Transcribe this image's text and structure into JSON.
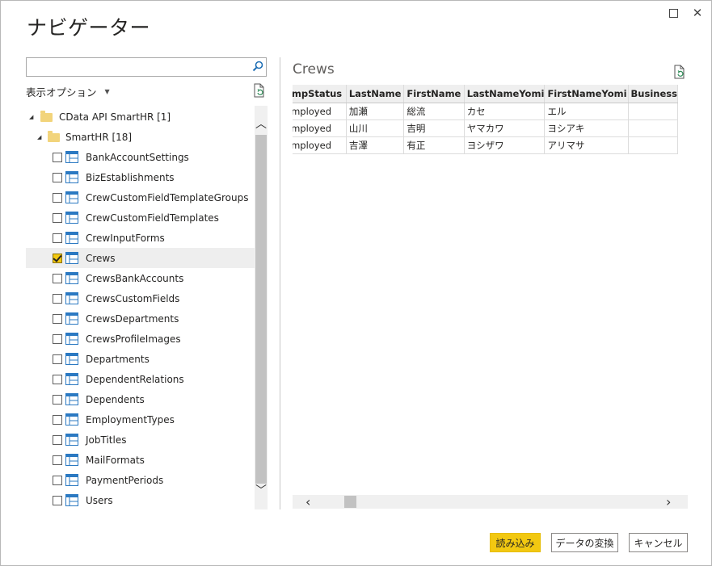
{
  "window": {
    "title": "ナビゲーター"
  },
  "navigator": {
    "search": {
      "value": "",
      "placeholder": ""
    },
    "display_options_label": "表示オプション",
    "tree": {
      "root": {
        "label": "CData API SmartHR [1]"
      },
      "folder": {
        "label": "SmartHR [18]"
      },
      "items": [
        {
          "label": "BankAccountSettings",
          "checked": false
        },
        {
          "label": "BizEstablishments",
          "checked": false
        },
        {
          "label": "CrewCustomFieldTemplateGroups",
          "checked": false
        },
        {
          "label": "CrewCustomFieldTemplates",
          "checked": false
        },
        {
          "label": "CrewInputForms",
          "checked": false
        },
        {
          "label": "Crews",
          "checked": true
        },
        {
          "label": "CrewsBankAccounts",
          "checked": false
        },
        {
          "label": "CrewsCustomFields",
          "checked": false
        },
        {
          "label": "CrewsDepartments",
          "checked": false
        },
        {
          "label": "CrewsProfileImages",
          "checked": false
        },
        {
          "label": "Departments",
          "checked": false
        },
        {
          "label": "DependentRelations",
          "checked": false
        },
        {
          "label": "Dependents",
          "checked": false
        },
        {
          "label": "EmploymentTypes",
          "checked": false
        },
        {
          "label": "JobTitles",
          "checked": false
        },
        {
          "label": "MailFormats",
          "checked": false
        },
        {
          "label": "PaymentPeriods",
          "checked": false
        },
        {
          "label": "Users",
          "checked": false
        }
      ]
    }
  },
  "preview": {
    "title": "Crews",
    "columns": [
      "EmpStatus",
      "LastName",
      "FirstName",
      "LastNameYomi",
      "FirstNameYomi",
      "Business"
    ],
    "rows": [
      [
        "employed",
        "加瀬",
        "総流",
        "カセ",
        "エル",
        ""
      ],
      [
        "employed",
        "山川",
        "吉明",
        "ヤマカワ",
        "ヨシアキ",
        ""
      ],
      [
        "employed",
        "吉澤",
        "有正",
        "ヨシザワ",
        "アリマサ",
        ""
      ]
    ]
  },
  "footer": {
    "load_label": "読み込み",
    "transform_label": "データの変換",
    "cancel_label": "キャンセル"
  },
  "colors": {
    "accent": "#f2c811",
    "folder": "#f2d47b",
    "table_icon": "#2b79c2"
  }
}
